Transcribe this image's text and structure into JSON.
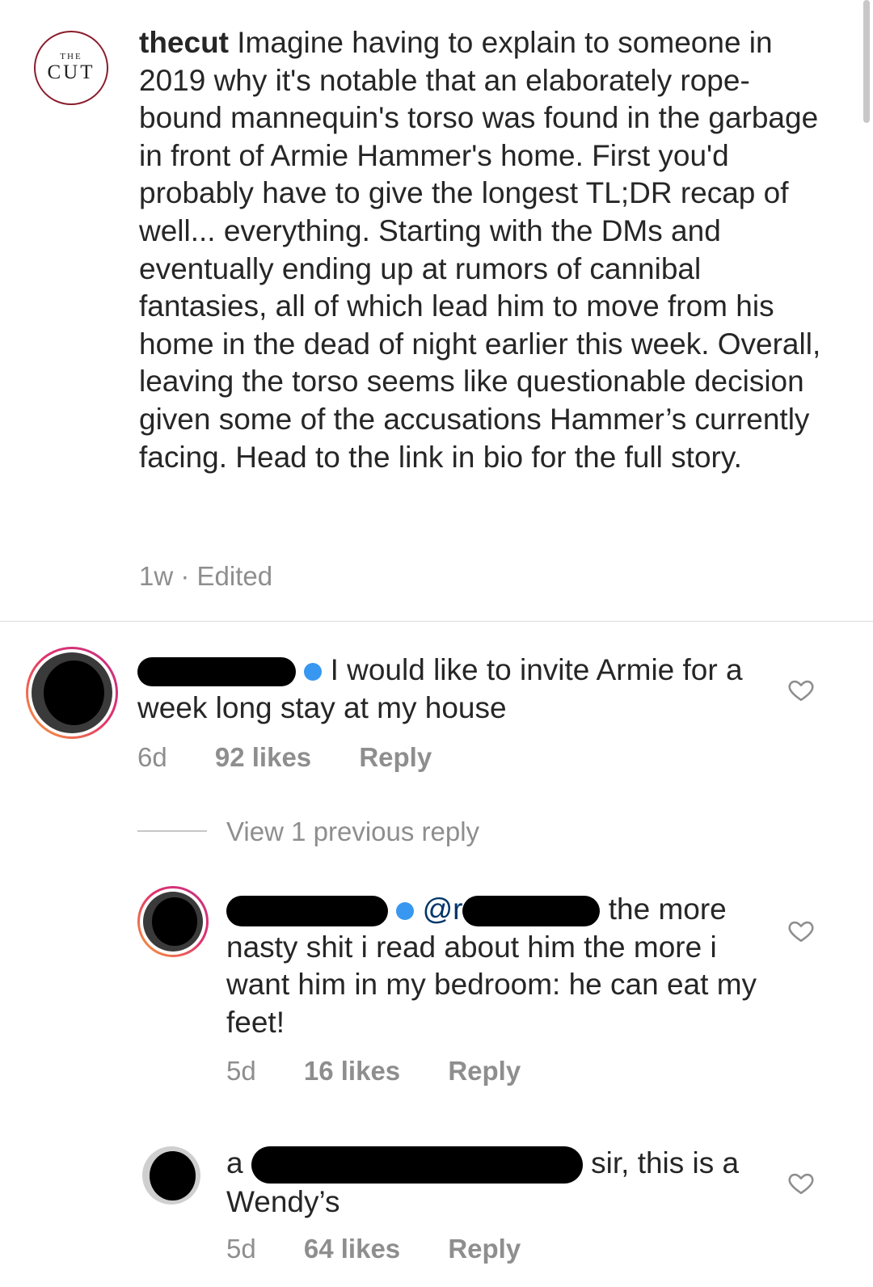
{
  "caption": {
    "username": "thecut",
    "text": "Imagine having to explain to someone in 2019 why it's notable that an elaborately rope-bound mannequin's torso was found in the garbage in front of Armie Hammer's home. First you'd probably have to give the longest TL;DR recap of well... everything. Starting with the DMs and eventually ending up at rumors of cannibal fantasies, all of which lead him to move from his home in the dead of night earlier this week. Overall, leaving the torso seems like questionable decision given some of the accusations Hammer’s currently facing. Head to the link in bio for the full story.",
    "time": "1w",
    "separator": "·",
    "edited": "Edited",
    "logo": {
      "top": "THE",
      "bottom": "CUT"
    }
  },
  "comments": [
    {
      "text": "I would like to invite Armie for a week long stay at my house",
      "time": "6d",
      "likes": "92 likes",
      "reply": "Reply"
    }
  ],
  "view_replies": "View 1 previous reply",
  "replies": [
    {
      "mention": "@r",
      "text_line1": "the more",
      "text_rest": "nasty shit i read about him the more i want him in my bedroom: he can eat my feet!",
      "time": "5d",
      "likes": "16 likes",
      "reply": "Reply"
    },
    {
      "username_visible": "a",
      "text_line1": "sir, this is a",
      "text_rest": "Wendy’s",
      "time": "5d",
      "likes": "64 likes",
      "reply": "Reply"
    }
  ],
  "icons": {
    "like": "heart-outline-icon"
  },
  "colors": {
    "ring_start": "#f9a13a",
    "ring_end": "#c13584",
    "meta": "#8e8e8e",
    "logo_border": "#8a1c2b"
  }
}
